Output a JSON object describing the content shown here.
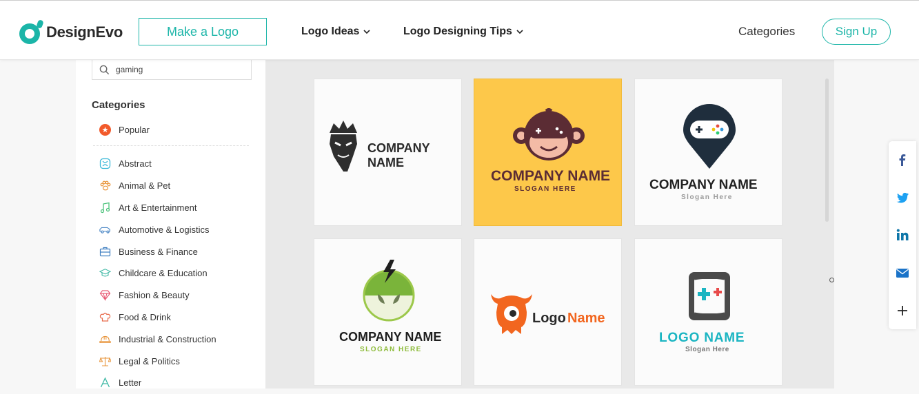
{
  "header": {
    "brand": "DesignEvo",
    "make_logo": "Make a Logo",
    "logo_ideas": "Logo Ideas",
    "logo_tips": "Logo Designing Tips",
    "categories": "Categories",
    "sign_up": "Sign Up"
  },
  "colors": {
    "accent": "#1bb5a8",
    "popular": "#f25a2b",
    "yellow_card": "#fdc84a"
  },
  "sidebar": {
    "search_value": "gaming",
    "categories_title": "Categories",
    "popular": "Popular",
    "items": [
      {
        "label": "Abstract",
        "icon": "abstract-icon"
      },
      {
        "label": "Animal & Pet",
        "icon": "paw-icon"
      },
      {
        "label": "Art & Entertainment",
        "icon": "music-note-icon"
      },
      {
        "label": "Automotive & Logistics",
        "icon": "car-icon"
      },
      {
        "label": "Business & Finance",
        "icon": "briefcase-icon"
      },
      {
        "label": "Childcare & Education",
        "icon": "graduation-cap-icon"
      },
      {
        "label": "Fashion & Beauty",
        "icon": "diamond-icon"
      },
      {
        "label": "Food & Drink",
        "icon": "chef-hat-icon"
      },
      {
        "label": "Industrial & Construction",
        "icon": "hard-hat-icon"
      },
      {
        "label": "Legal & Politics",
        "icon": "scales-icon"
      },
      {
        "label": "Letter",
        "icon": "letter-a-icon"
      }
    ]
  },
  "gallery": {
    "cards": [
      {
        "name": "COMPANY\nNAME",
        "line1": "COMPANY",
        "line2": "NAME"
      },
      {
        "name": "COMPANY NAME",
        "slogan": "SLOGAN HERE"
      },
      {
        "name": "COMPANY NAME",
        "slogan": "Slogan Here"
      },
      {
        "name": "COMPANY NAME",
        "slogan": "SLOGAN HERE"
      },
      {
        "name_a": "Logo",
        "name_b": "Name"
      },
      {
        "name": "LOGO NAME",
        "slogan": "Slogan Here"
      }
    ]
  },
  "share": [
    "facebook-icon",
    "twitter-icon",
    "linkedin-icon",
    "email-icon",
    "plus-icon"
  ]
}
